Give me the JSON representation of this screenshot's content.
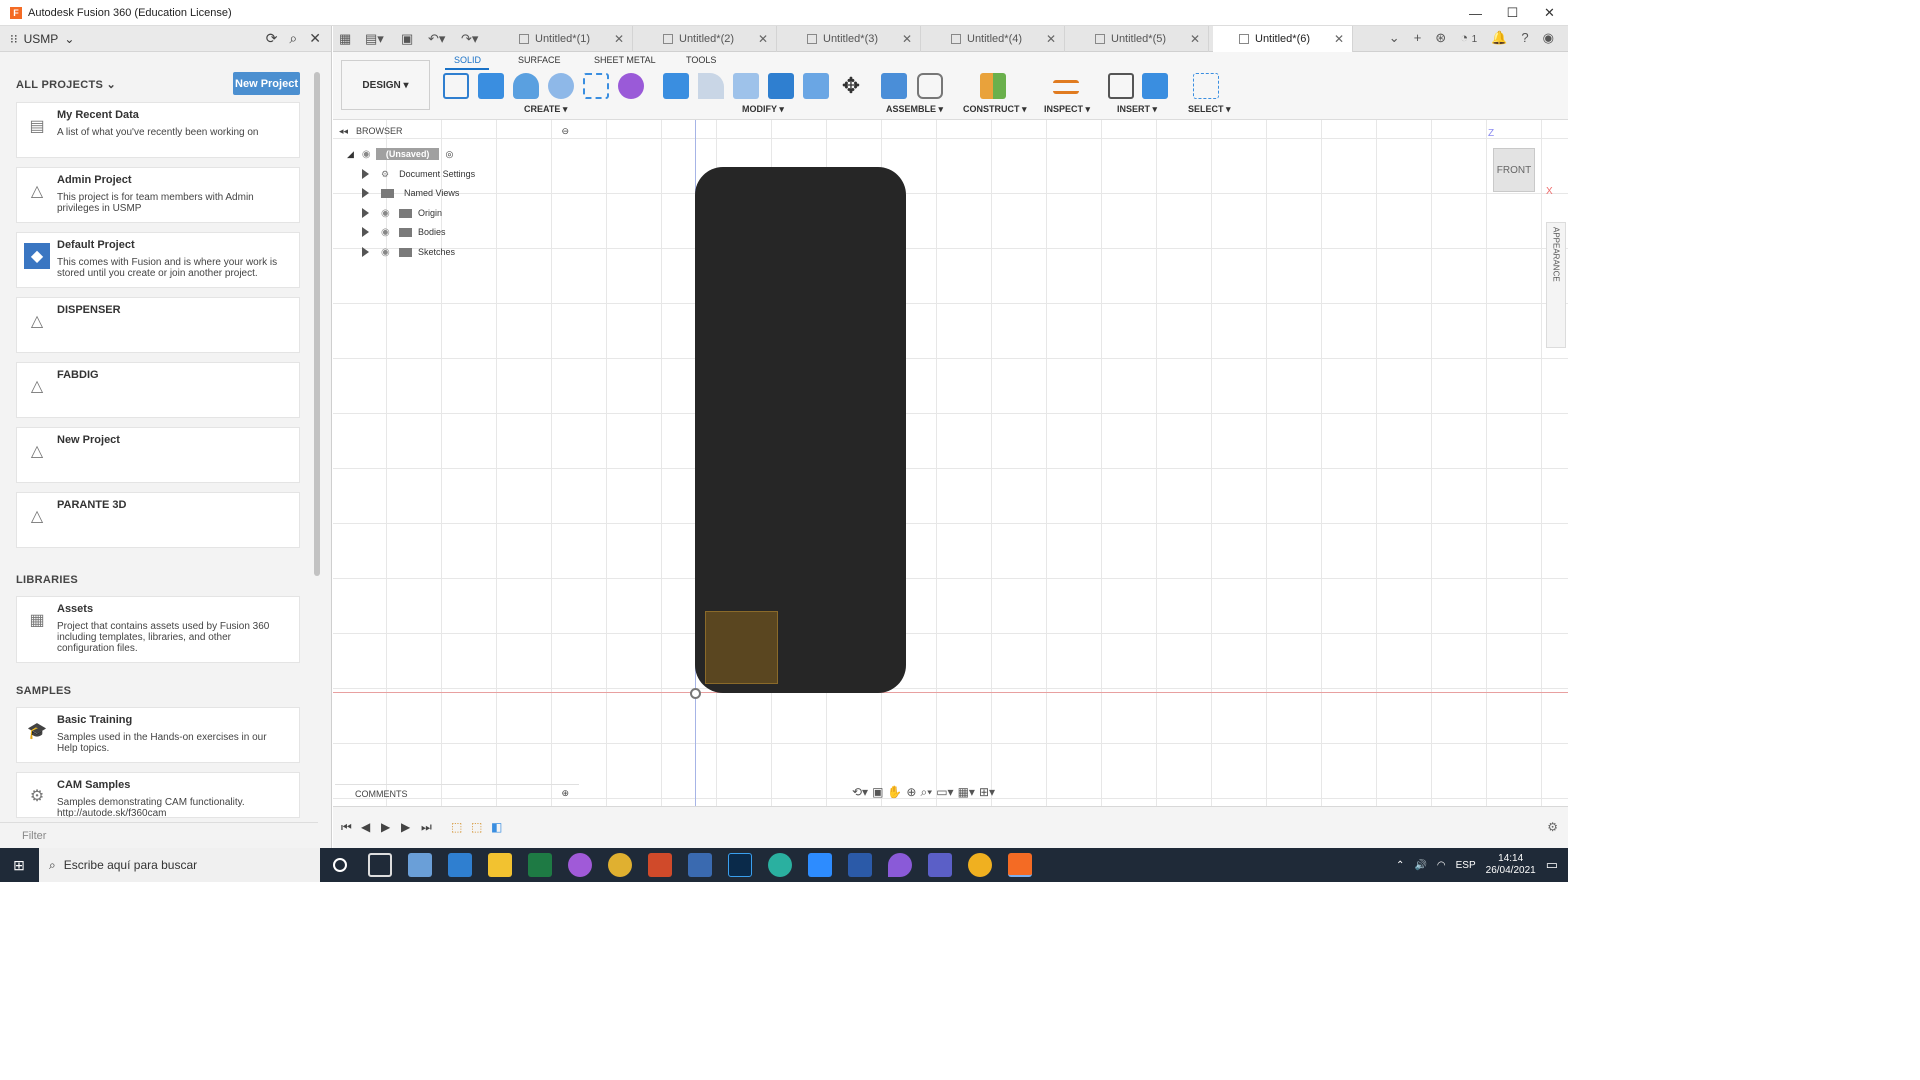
{
  "window": {
    "title": "Autodesk Fusion 360 (Education License)",
    "controls": [
      "minimize",
      "maximize",
      "close"
    ]
  },
  "left_panel": {
    "team": "USMP",
    "all_projects_label": "ALL PROJECTS",
    "new_project_button": "New Project",
    "projects": [
      {
        "title": "My Recent Data",
        "desc": "A list of what you've recently been working on",
        "icon": "recent-data-icon"
      },
      {
        "title": "Admin Project",
        "desc": "This project is for team members with Admin privileges in USMP",
        "icon": "project-icon"
      },
      {
        "title": "Default Project",
        "desc": "This comes with Fusion and is where your work is stored until you create or join another project.",
        "icon": "default-project-icon"
      },
      {
        "title": "DISPENSER",
        "desc": "",
        "icon": "project-icon"
      },
      {
        "title": "FABDIG",
        "desc": "",
        "icon": "project-icon"
      },
      {
        "title": "New Project",
        "desc": "",
        "icon": "project-icon"
      },
      {
        "title": "PARANTE 3D",
        "desc": "",
        "icon": "project-icon"
      }
    ],
    "libraries_label": "LIBRARIES",
    "libraries": [
      {
        "title": "Assets",
        "desc": "Project that contains assets used by Fusion 360 including templates, libraries, and other configuration files.",
        "icon": "assets-icon"
      }
    ],
    "samples_label": "SAMPLES",
    "samples": [
      {
        "title": "Basic Training",
        "desc": "Samples used in the Hands-on exercises in our Help topics.",
        "icon": "training-icon"
      },
      {
        "title": "CAM Samples",
        "desc": "Samples demonstrating CAM functionality. http://autode.sk/f360cam",
        "icon": "cam-icon"
      }
    ],
    "filter_placeholder": "Filter"
  },
  "tabs": [
    "Untitled*(1)",
    "Untitled*(2)",
    "Untitled*(3)",
    "Untitled*(4)",
    "Untitled*(5)",
    "Untitled*(6)"
  ],
  "active_tab": "Untitled*(6)",
  "tab_bar_right": {
    "jobs_count": "1"
  },
  "toolbar": {
    "workspace": "DESIGN ▾",
    "workspace_tabs": [
      "SOLID",
      "SURFACE",
      "SHEET METAL",
      "TOOLS"
    ],
    "active_workspace_tab": "SOLID",
    "groups": [
      "CREATE ▾",
      "MODIFY ▾",
      "ASSEMBLE ▾",
      "CONSTRUCT ▾",
      "INSPECT ▾",
      "INSERT ▾",
      "SELECT ▾"
    ]
  },
  "browser": {
    "title": "BROWSER",
    "root": "(Unsaved)",
    "items": [
      "Document Settings",
      "Named Views",
      "Origin",
      "Bodies",
      "Sketches"
    ]
  },
  "viewcube": {
    "face": "FRONT",
    "axis_z": "Z",
    "axis_x": "X"
  },
  "appearance_panel": "APPEARANCE",
  "comments_label": "COMMENTS",
  "taskbar": {
    "search_placeholder": "Escribe aquí para buscar",
    "language": "ESP",
    "time": "14:14",
    "date": "26/04/2021"
  },
  "colors": {
    "accent": "#1a72c7",
    "new_project_button": "#4b8fd0",
    "body": "#262626",
    "sketch_profile": "#5a4620",
    "taskbar": "#1f2a38"
  }
}
